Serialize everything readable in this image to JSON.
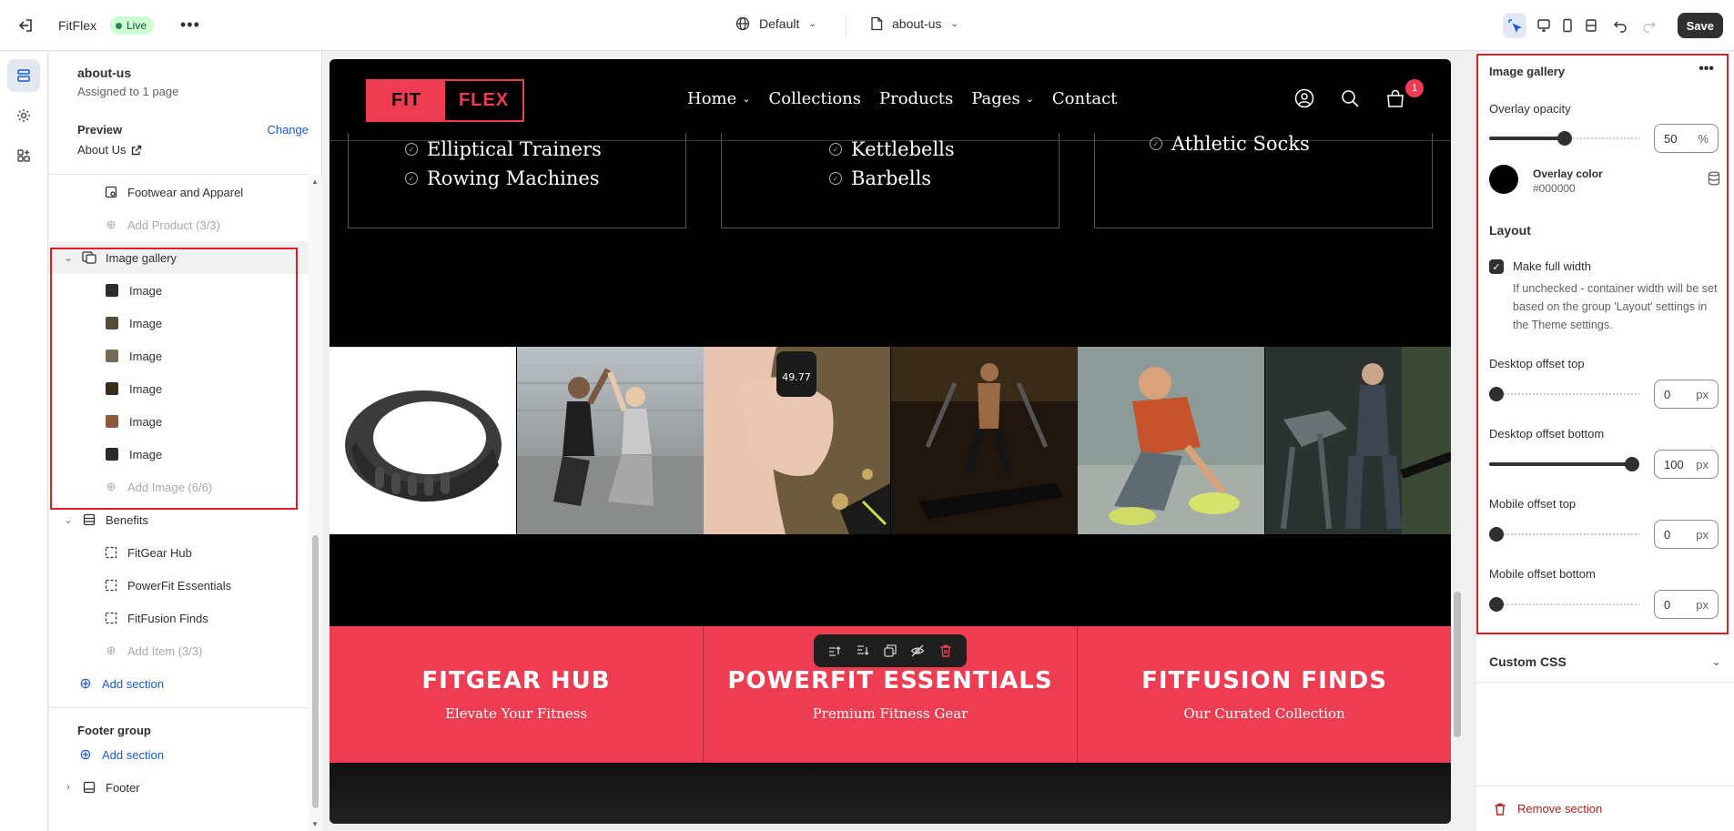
{
  "topbar": {
    "store_name": "FitFlex",
    "status_badge": "Live",
    "theme_select": "Default",
    "page_select": "about-us",
    "save_label": "Save"
  },
  "sidebar": {
    "page_title": "about-us",
    "assigned": "Assigned to 1 page",
    "preview_label": "Preview",
    "change_link": "Change",
    "preview_page": "About Us",
    "footwear": "Footwear and Apparel",
    "add_product": "Add Product (3/3)",
    "gallery_section": "Image gallery",
    "gallery_items": [
      {
        "label": "Image",
        "thumb": "#2b2b2b"
      },
      {
        "label": "Image",
        "thumb": "#5a4a3a"
      },
      {
        "label": "Image",
        "thumb": "#7a6a5a"
      },
      {
        "label": "Image",
        "thumb": "#3a2a1a"
      },
      {
        "label": "Image",
        "thumb": "#8a5a3a"
      },
      {
        "label": "Image",
        "thumb": "#2a2a2a"
      }
    ],
    "add_image": "Add Image (6/6)",
    "benefits_section": "Benefits",
    "benefit_items": [
      "FitGear Hub",
      "PowerFit Essentials",
      "FitFusion Finds"
    ],
    "add_item": "Add Item (3/3)",
    "add_section": "Add section",
    "footer_group": "Footer group",
    "add_section_footer": "Add section",
    "footer": "Footer"
  },
  "preview": {
    "logo_left": "FIT",
    "logo_right": "FLEX",
    "nav": [
      "Home",
      "Collections",
      "Products",
      "Pages",
      "Contact"
    ],
    "cart_count": "1",
    "card1": [
      "Elliptical Trainers",
      "Rowing Machines"
    ],
    "card2": [
      "Kettlebells",
      "Barbells"
    ],
    "card3": [
      "Athletic Socks"
    ],
    "watch_reading": "49.77",
    "benefits": [
      {
        "title": "FITGEAR HUB",
        "subtitle": "Elevate Your Fitness"
      },
      {
        "title": "POWERFIT ESSENTIALS",
        "subtitle": "Premium Fitness Gear"
      },
      {
        "title": "FITFUSION FINDS",
        "subtitle": "Our Curated Collection"
      }
    ],
    "accent_color": "#ee3d52"
  },
  "settings": {
    "section_title": "Image gallery",
    "overlay_opacity_label": "Overlay opacity",
    "overlay_opacity": {
      "value": "50",
      "unit": "%",
      "fraction": 0.5
    },
    "overlay_color_label": "Overlay color",
    "overlay_color_value": "#000000",
    "layout_heading": "Layout",
    "full_width_label": "Make full width",
    "full_width_help": "If unchecked - container width will be set based on the group 'Layout' settings in the Theme settings.",
    "desktop_top_label": "Desktop offset top",
    "desktop_top": {
      "value": "0",
      "unit": "px",
      "fraction": 0.0
    },
    "desktop_bottom_label": "Desktop offset bottom",
    "desktop_bottom": {
      "value": "100",
      "unit": "px",
      "fraction": 1.0
    },
    "mobile_top_label": "Mobile offset top",
    "mobile_top": {
      "value": "0",
      "unit": "px",
      "fraction": 0.0
    },
    "mobile_bottom_label": "Mobile offset bottom",
    "mobile_bottom": {
      "value": "0",
      "unit": "px",
      "fraction": 0.0
    },
    "custom_css": "Custom CSS",
    "remove_section": "Remove section"
  }
}
